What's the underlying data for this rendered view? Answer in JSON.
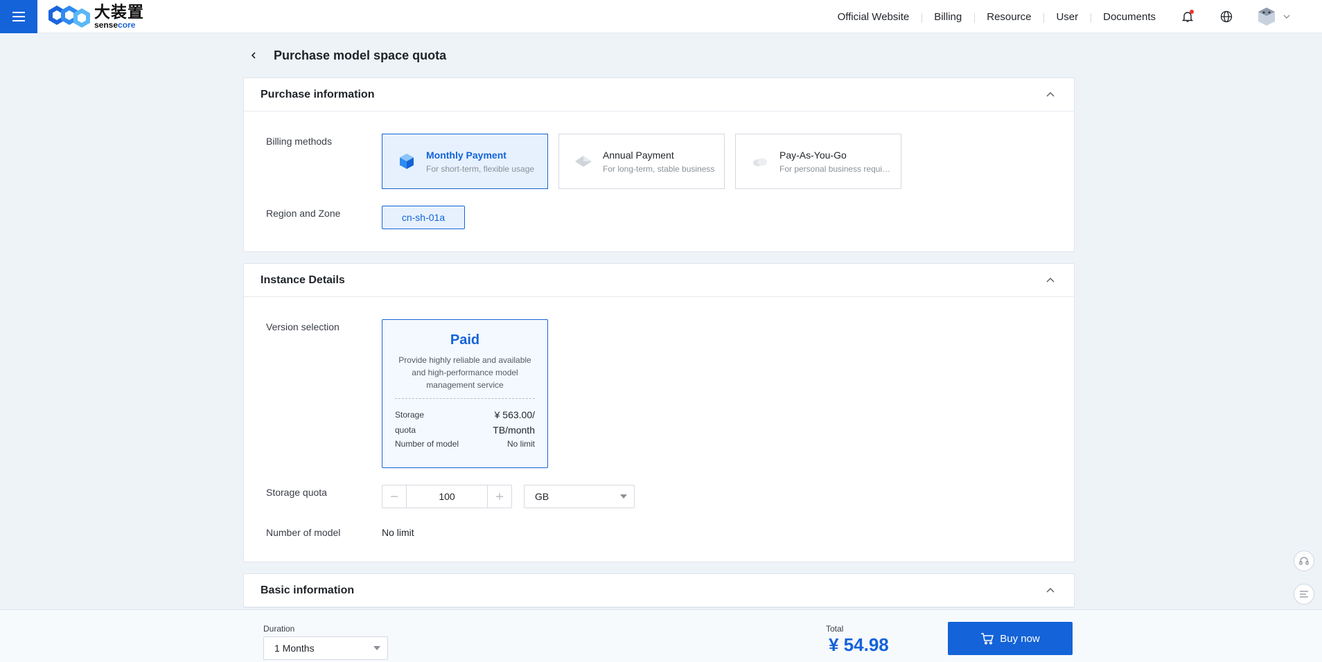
{
  "colors": {
    "primary": "#1463d8",
    "background": "#eef3f8",
    "notification_dot": "#f0302e"
  },
  "header": {
    "logo_cn": "大装置",
    "logo_en_a": "sense",
    "logo_en_b": "core",
    "nav": [
      "Official Website",
      "Billing",
      "Resource",
      "User",
      "Documents"
    ],
    "icons": [
      "menu-icon",
      "bell-icon",
      "globe-icon",
      "avatar",
      "chevron-down-icon"
    ]
  },
  "page": {
    "title": "Purchase model space quota"
  },
  "purchase_info": {
    "title": "Purchase information",
    "billing_label": "Billing methods",
    "billing_options": [
      {
        "name": "Monthly Payment",
        "desc": "For short-term, flexible usage",
        "selected": true
      },
      {
        "name": "Annual Payment",
        "desc": "For long-term, stable business",
        "selected": false
      },
      {
        "name": "Pay-As-You-Go",
        "desc": "For personal business requirements",
        "selected": false
      }
    ],
    "region_label": "Region and Zone",
    "region_value": "cn-sh-01a"
  },
  "instance": {
    "title": "Instance Details",
    "version_label": "Version selection",
    "version": {
      "name": "Paid",
      "desc": "Provide highly reliable and available and high-performance model management service",
      "spec1_label": "Storage quota",
      "spec1_value": "¥ 563.00/ TB/month",
      "spec2_label": "Number of model",
      "spec2_value": "No limit"
    },
    "storage_label": "Storage quota",
    "storage_value": "100",
    "storage_unit": "GB",
    "model_label": "Number of model",
    "model_value": "No limit"
  },
  "basic": {
    "title": "Basic information"
  },
  "footer": {
    "duration_label": "Duration",
    "duration_value": "1 Months",
    "total_label": "Total",
    "total_value": "¥ 54.98",
    "buy_label": "Buy now"
  }
}
